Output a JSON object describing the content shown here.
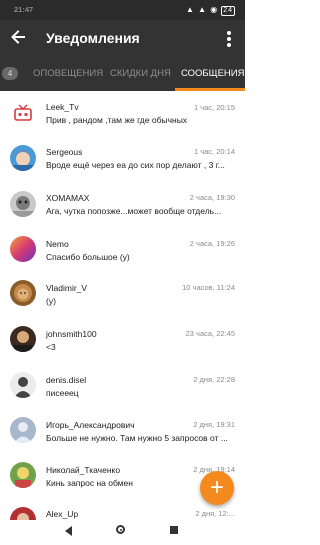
{
  "status_bar": {
    "time": "21:47",
    "signal": "▲ ▲ ◉",
    "battery": "24"
  },
  "app_bar": {
    "title": "Уведомления"
  },
  "tabs": {
    "badge": "4",
    "items": [
      {
        "label": "ОПОВЕЩЕНИЯ"
      },
      {
        "label": "СКИДКИ ДНЯ"
      },
      {
        "label": "СООБЩЕНИЯ"
      }
    ],
    "active": "СООБЩЕНИЯ"
  },
  "messages": [
    {
      "name": "Leek_Tv",
      "time": "1 час, 20:15",
      "preview": "Прив , рандом ,там же где обычных",
      "avatar": "tv-icon",
      "color": "#ffffff"
    },
    {
      "name": "Sergeous",
      "time": "1 час, 20:14",
      "preview": "Вроде ещё через еа до сих пор делают , 3 г...",
      "avatar": "anime-avatar",
      "color": "#4a9ad6"
    },
    {
      "name": "XOMAMAX",
      "time": "2 часа, 19:30",
      "preview": "Ага, чутка попозже...может вообще отдель...",
      "avatar": "gray-avatar",
      "color": "#b5b5b5"
    },
    {
      "name": "Nemo",
      "time": "2 часа, 19:26",
      "preview": "Спасибо большое  (y)",
      "avatar": "gradient-avatar",
      "color": "#c13a8c"
    },
    {
      "name": "Vladimir_V",
      "time": "10 часов, 11:24",
      "preview": "(y)",
      "avatar": "lion-avatar",
      "color": "#8a5b2b"
    },
    {
      "name": "johnsmith100",
      "time": "23 часа, 22:45",
      "preview": "<3",
      "avatar": "dark-avatar",
      "color": "#3b2a1f"
    },
    {
      "name": "denis.disel",
      "time": "2 дня, 22:28",
      "preview": "писееец",
      "avatar": "silhouette-avatar",
      "color": "#e6e6e6"
    },
    {
      "name": "Игорь_Александрович",
      "time": "2 дня, 19:31",
      "preview": "Больше не нужно. Там нужно 5 запросов от ...",
      "avatar": "default-avatar",
      "color": "#9eb0c8"
    },
    {
      "name": "Николай_Ткаченко",
      "time": "2 дня, 19:14",
      "preview": "Кинь запрос на обмен",
      "avatar": "game-avatar",
      "color": "#6fa24a"
    },
    {
      "name": "Alex_Up",
      "time": "2 дня, 12:...",
      "preview": "",
      "avatar": "partial-avatar",
      "color": "#b23030"
    }
  ],
  "fab": {
    "label": "+"
  },
  "colors": {
    "accent": "#f48a1c",
    "appbar": "#333333"
  }
}
